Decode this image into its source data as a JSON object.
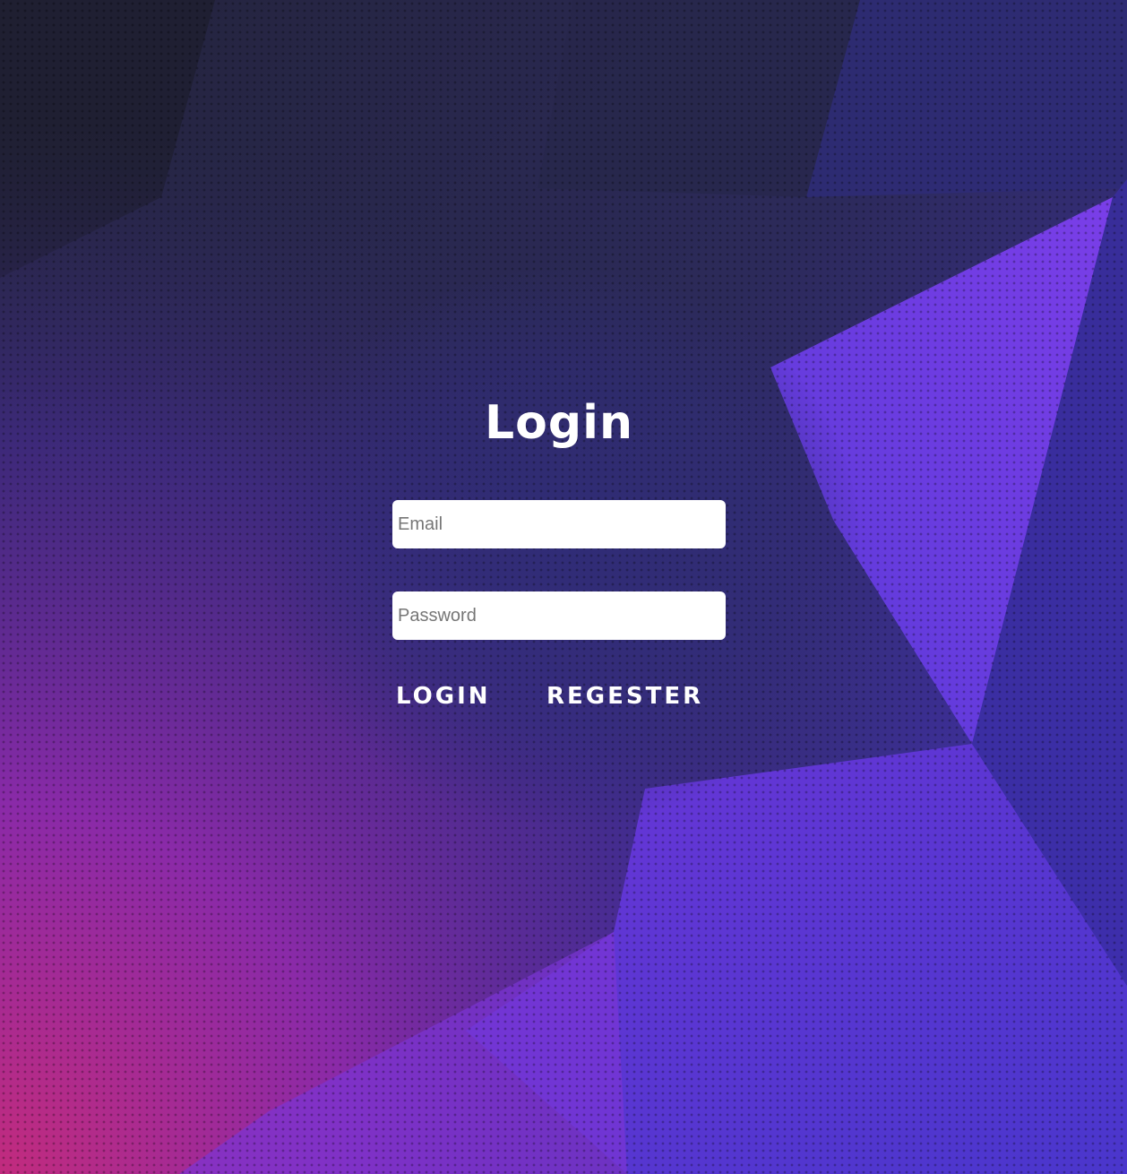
{
  "login": {
    "title": "Login",
    "email_placeholder": "Email",
    "password_placeholder": "Password",
    "login_button": "LOGIN",
    "register_button": "REGESTER"
  },
  "colors": {
    "background_dark": "#26263f",
    "background_purple": "#5a3cd6",
    "background_pink": "#c0307c",
    "button_text": "#ffffff",
    "input_background": "#ffffff"
  }
}
